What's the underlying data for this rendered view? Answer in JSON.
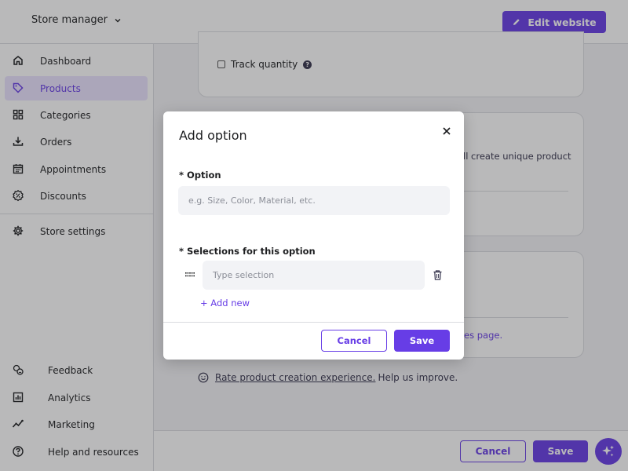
{
  "header": {
    "store_label": "Store manager",
    "edit_website_label": "Edit website"
  },
  "sidebar": {
    "items": [
      {
        "label": "Dashboard",
        "icon": "home-icon"
      },
      {
        "label": "Products",
        "icon": "tag-icon",
        "active": true
      },
      {
        "label": "Categories",
        "icon": "grid-icon"
      },
      {
        "label": "Orders",
        "icon": "download-icon"
      },
      {
        "label": "Appointments",
        "icon": "calendar-icon"
      },
      {
        "label": "Discounts",
        "icon": "discount-badge-icon"
      },
      {
        "label": "Store settings",
        "icon": "gear-icon"
      }
    ],
    "bottom_items": [
      {
        "label": "Feedback",
        "icon": "feedback-icon"
      },
      {
        "label": "Analytics",
        "icon": "analytics-icon"
      },
      {
        "label": "Marketing",
        "icon": "trend-icon"
      },
      {
        "label": "Help and resources",
        "icon": "question-icon"
      }
    ]
  },
  "main": {
    "track_quantity_label": "Track quantity",
    "options_card_text": "ll create unique product",
    "variants_card_link": "es page.",
    "rate_link": "Rate product creation experience.",
    "rate_suffix": "Help us improve."
  },
  "footer": {
    "cancel_label": "Cancel",
    "save_label": "Save"
  },
  "modal": {
    "title": "Add option",
    "option_label": "* Option",
    "option_placeholder": "e.g. Size, Color, Material, etc.",
    "option_value": "",
    "selections_label": "* Selections for this option",
    "selection_placeholder": "Type selection",
    "selection_value": "",
    "add_new_label": "+ Add new",
    "cancel_label": "Cancel",
    "save_label": "Save"
  },
  "colors": {
    "accent": "#673de6",
    "accent_light": "#ebe4ff",
    "text": "#1d1e20",
    "border": "#dadce0"
  }
}
